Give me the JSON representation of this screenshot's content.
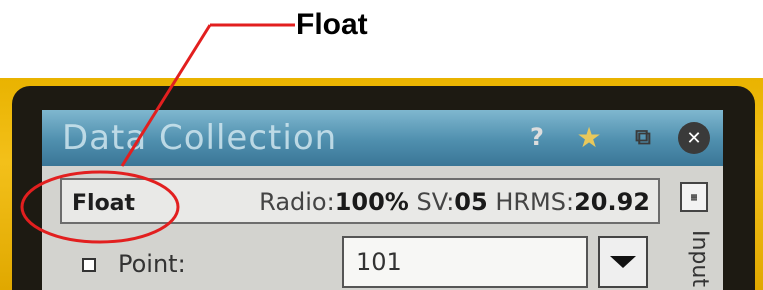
{
  "callout": {
    "label": "Float"
  },
  "titlebar": {
    "title": "Data Collection",
    "icons": [
      "help-icon",
      "favorite-icon",
      "copy-icon",
      "close-icon"
    ]
  },
  "status": {
    "mode": "Float",
    "radio_label": "Radio:",
    "radio_value": "100%",
    "sv_label": "SV:",
    "sv_value": "05",
    "hrms_label": "HRMS:",
    "hrms_value": "20.92"
  },
  "side": {
    "tab_label": "Input"
  },
  "point": {
    "label": "Point:",
    "value": "101"
  },
  "colors": {
    "callout": "#e21f1f",
    "titlebar": "#4f8fae",
    "device": "#f0b800"
  }
}
